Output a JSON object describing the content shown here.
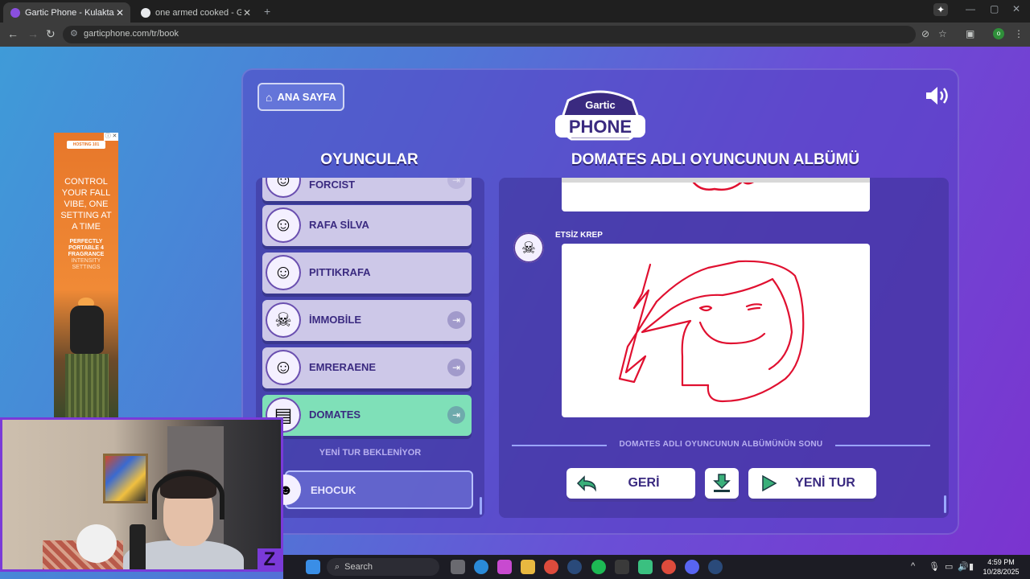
{
  "browser": {
    "tabs": [
      {
        "title": "Gartic Phone - Kulaktan Kulağa",
        "active": true
      },
      {
        "title": "one armed cooked - Google'da",
        "active": false
      }
    ],
    "url": "garticphone.com/tr/book"
  },
  "ad": {
    "brand": "HOSTING 101",
    "headline": "CONTROL YOUR FALL VIBE, ONE SETTING AT A TIME",
    "subline": "PERFECTLY PORTABLE 4 FRAGRANCE",
    "subline2": "INTENSITY SETTINGS"
  },
  "game": {
    "home_label": "ANA SAYFA",
    "logo_top": "Gartic",
    "logo_bottom": "PHONE",
    "players_heading": "OYUNCULAR",
    "album_heading": "DOMATES ADLI OYUNCUNUN ALBÜMÜ",
    "players": [
      {
        "name": "FORCIST",
        "kick": false,
        "active": false
      },
      {
        "name": "RAFA SİLVA",
        "kick": false,
        "active": false
      },
      {
        "name": "PITTIKRAFA",
        "kick": false,
        "active": false
      },
      {
        "name": "İMMOBİLE",
        "kick": true,
        "active": false
      },
      {
        "name": "EMRERAENE",
        "kick": true,
        "active": false
      },
      {
        "name": "DOMATES",
        "kick": true,
        "active": true
      }
    ],
    "waiting_label": "YENİ TUR BEKLENİYOR",
    "waiting_players": [
      {
        "name": "EHOCUK"
      }
    ],
    "album": {
      "author": "ETSİZ KREP",
      "end_label": "DOMATES ADLI OYUNCUNUN ALBÜMÜNÜN SONU",
      "back_label": "GERİ",
      "new_round_label": "YENİ TUR"
    }
  },
  "taskbar": {
    "search_label": "Search",
    "time": "4:59 PM",
    "date": "10/28/2025"
  },
  "colors": {
    "accent": "#7fe0b8",
    "panel": "#5642c4",
    "drawing_ink": "#e01030"
  }
}
